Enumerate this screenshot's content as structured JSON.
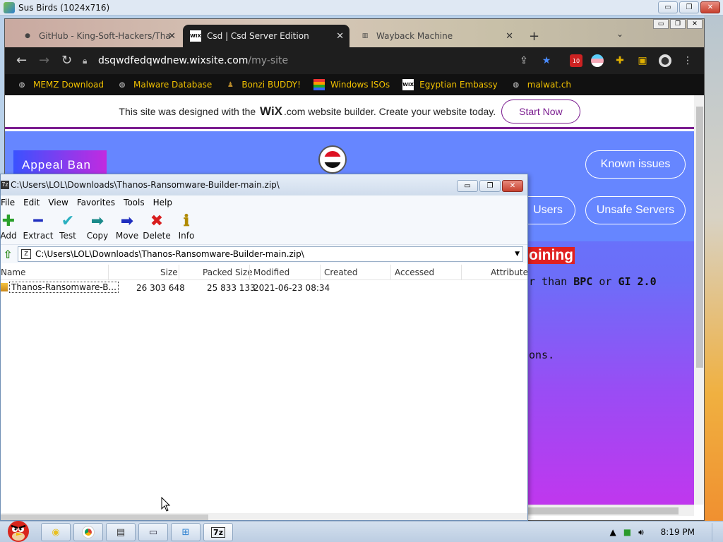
{
  "vm": {
    "title": "Sus Birds (1024x716)",
    "btn_min": "▭",
    "btn_max": "❐",
    "btn_close": "✕"
  },
  "browser": {
    "tabs": [
      {
        "label": "GitHub - King-Soft-Hackers/Tha",
        "icon": "github-icon"
      },
      {
        "label": "Csd | Csd Server Edition",
        "icon": "wix-icon",
        "favicon_text": "WIX"
      },
      {
        "label": "Wayback Machine",
        "icon": "wayback-icon"
      }
    ],
    "new_tab": "+",
    "url_host": "dsqwdfedqwdnew.wixsite.com",
    "url_path": "/my-site",
    "extension_badge": "10",
    "bookmarks": [
      {
        "label": "MEMZ Download",
        "icon": "globe-icon"
      },
      {
        "label": "Malware Database",
        "icon": "globe-icon"
      },
      {
        "label": "Bonzi BUDDY!",
        "icon": "bonzi-icon"
      },
      {
        "label": "Windows ISOs",
        "icon": "windows-flag-icon"
      },
      {
        "label": "Egyptian Embassy",
        "icon": "wix-icon",
        "favicon_text": "WIX"
      },
      {
        "label": "malwat.ch",
        "icon": "globe-icon"
      }
    ]
  },
  "wix_banner": {
    "pre": "This site was designed with the",
    "logo": "WiX",
    "domain": ".com",
    "post": "website builder. Create your website today.",
    "button": "Start Now"
  },
  "site": {
    "appeal_button": "Appeal Ban",
    "known_issues": "Known issues",
    "users": "Users",
    "unsafe_servers": "Unsafe Servers",
    "joining": "oining",
    "line1_pre": "r than",
    "line1_b1": "BPC",
    "line1_mid": "or",
    "line1_b2": "GI 2.0",
    "line2": "ons."
  },
  "sevenzip": {
    "title": "C:\\Users\\LOL\\Downloads\\Thanos-Ransomware-Builder-main.zip\\",
    "app_icon_text": "7z",
    "menu": [
      "File",
      "Edit",
      "View",
      "Favorites",
      "Tools",
      "Help"
    ],
    "tools": [
      "Add",
      "Extract",
      "Test",
      "Copy",
      "Move",
      "Delete",
      "Info"
    ],
    "path": "C:\\Users\\LOL\\Downloads\\Thanos-Ransomware-Builder-main.zip\\",
    "columns": [
      "Name",
      "Size",
      "Packed Size",
      "Modified",
      "Created",
      "Accessed",
      "Attribute"
    ],
    "rows": [
      {
        "name": "Thanos-Ransomware-B...",
        "size": "26 303 648",
        "packed": "25 833 133",
        "modified": "2021-06-23 08:34"
      }
    ]
  },
  "taskbar": {
    "clock": "8:19 PM",
    "items": [
      "explorer",
      "chrome",
      "terminal",
      "window",
      "ie",
      "7z"
    ],
    "sevenzip_label": "7z"
  },
  "colors": {
    "accent": "#7a1b8f",
    "site_blue": "#6686ff",
    "joining_red": "#e02020",
    "bookmark_yellow": "#f0c000"
  }
}
